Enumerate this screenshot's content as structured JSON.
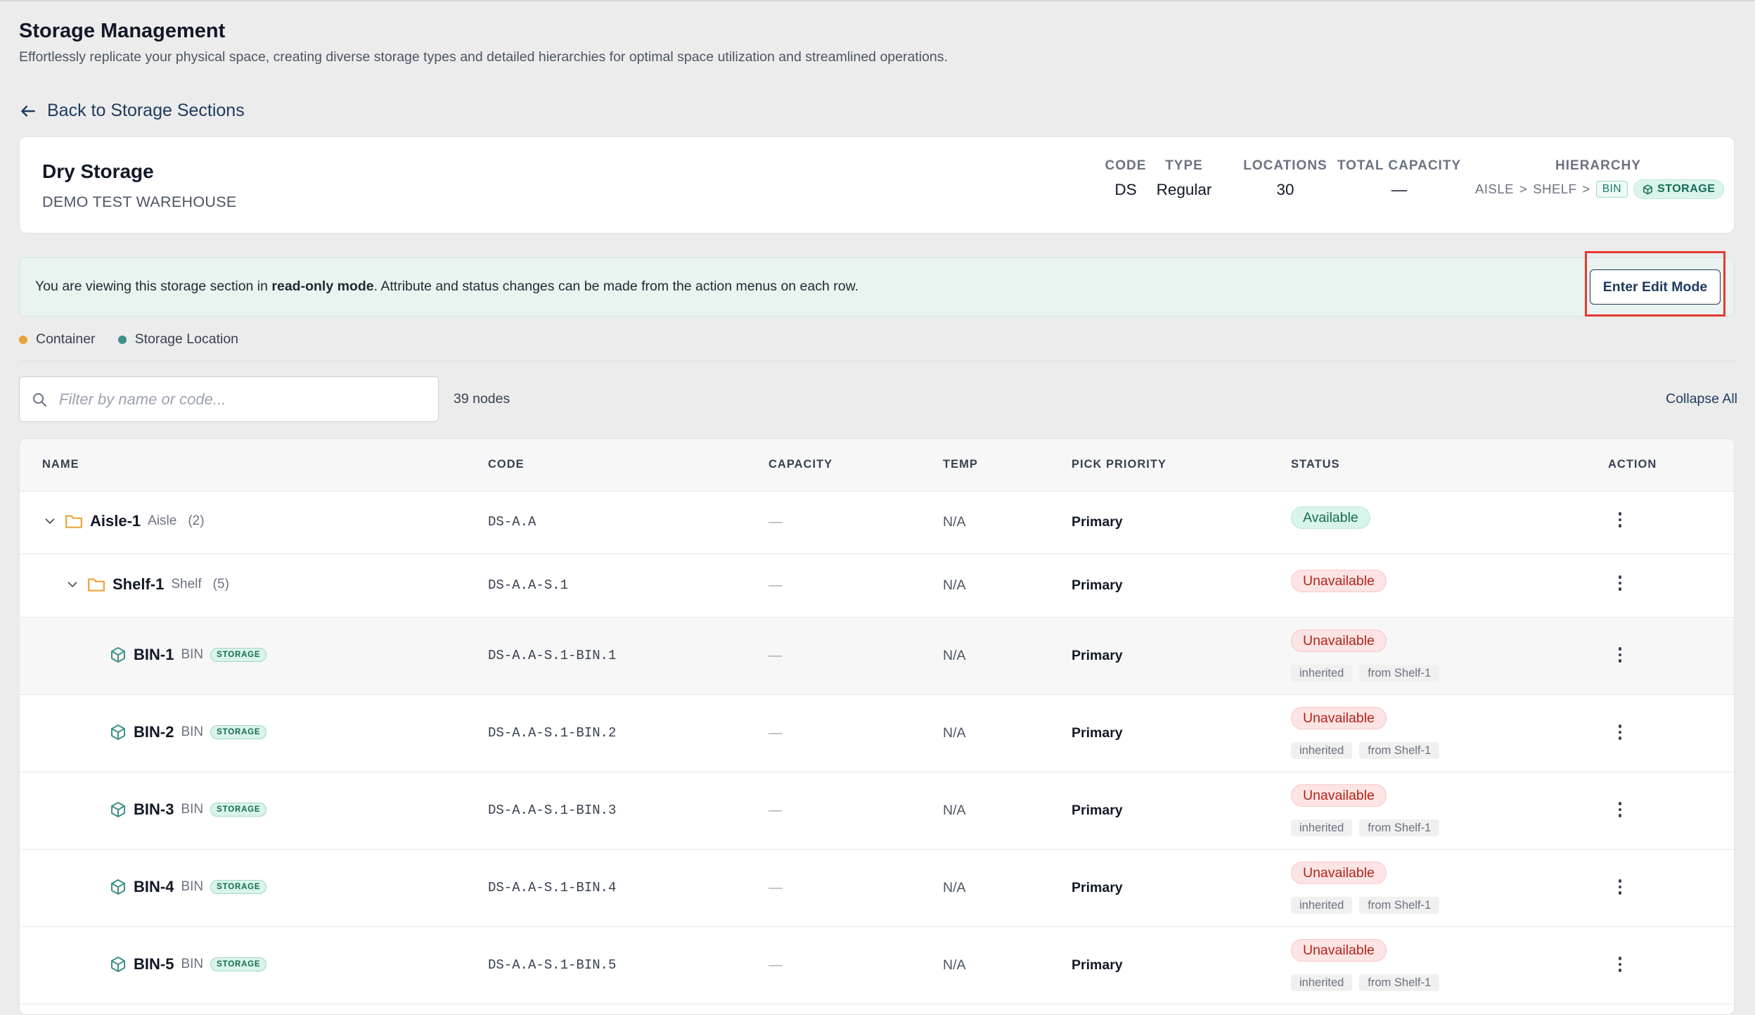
{
  "page": {
    "title": "Storage Management",
    "subtitle": "Effortlessly replicate your physical space, creating diverse storage types and detailed hierarchies for optimal space utilization and streamlined operations.",
    "back_label": "Back to Storage Sections"
  },
  "section": {
    "name": "Dry Storage",
    "warehouse": "DEMO TEST WAREHOUSE",
    "code_label": "CODE",
    "code": "DS",
    "type_label": "TYPE",
    "type": "Regular",
    "locations_label": "LOCATIONS",
    "locations": "30",
    "capacity_label": "TOTAL CAPACITY",
    "capacity": "—",
    "hierarchy_label": "HIERARCHY",
    "hierarchy": {
      "l1": "AISLE",
      "sep": ">",
      "l2": "SHELF",
      "l3": "BIN",
      "storage": "STORAGE"
    }
  },
  "notice": {
    "prefix": "You are viewing this storage section in ",
    "bold": "read-only mode",
    "suffix": ". Attribute and status changes can be made from the action menus on each row.",
    "button": "Enter Edit Mode"
  },
  "legend": {
    "container": "Container",
    "container_color": "#e8a23a",
    "storage": "Storage Location",
    "storage_color": "#3f8f8a"
  },
  "search": {
    "placeholder": "Filter by name or code...",
    "value": ""
  },
  "node_count": "39 nodes",
  "collapse_all": "Collapse All",
  "table": {
    "headers": {
      "name": "NAME",
      "code": "CODE",
      "capacity": "CAPACITY",
      "temp": "TEMP",
      "pick": "PICK PRIORITY",
      "status": "STATUS",
      "action": "ACTION"
    },
    "rows": [
      {
        "name": "Aisle-1",
        "type": "Aisle",
        "count": "(2)",
        "code": "DS-A.A",
        "capacity": "—",
        "temp": "N/A",
        "pick": "Primary",
        "status": "Available"
      },
      {
        "name": "Shelf-1",
        "type": "Shelf",
        "count": "(5)",
        "code": "DS-A.A-S.1",
        "capacity": "—",
        "temp": "N/A",
        "pick": "Primary",
        "status": "Unavailable"
      },
      {
        "name": "BIN-1",
        "type": "BIN",
        "badge": "STORAGE",
        "code": "DS-A.A-S.1-BIN.1",
        "capacity": "—",
        "temp": "N/A",
        "pick": "Primary",
        "status": "Unavailable",
        "tag1": "inherited",
        "tag2": "from Shelf-1"
      },
      {
        "name": "BIN-2",
        "type": "BIN",
        "badge": "STORAGE",
        "code": "DS-A.A-S.1-BIN.2",
        "capacity": "—",
        "temp": "N/A",
        "pick": "Primary",
        "status": "Unavailable",
        "tag1": "inherited",
        "tag2": "from Shelf-1"
      },
      {
        "name": "BIN-3",
        "type": "BIN",
        "badge": "STORAGE",
        "code": "DS-A.A-S.1-BIN.3",
        "capacity": "—",
        "temp": "N/A",
        "pick": "Primary",
        "status": "Unavailable",
        "tag1": "inherited",
        "tag2": "from Shelf-1"
      },
      {
        "name": "BIN-4",
        "type": "BIN",
        "badge": "STORAGE",
        "code": "DS-A.A-S.1-BIN.4",
        "capacity": "—",
        "temp": "N/A",
        "pick": "Primary",
        "status": "Unavailable",
        "tag1": "inherited",
        "tag2": "from Shelf-1"
      },
      {
        "name": "BIN-5",
        "type": "BIN",
        "badge": "STORAGE",
        "code": "DS-A.A-S.1-BIN.5",
        "capacity": "—",
        "temp": "N/A",
        "pick": "Primary",
        "status": "Unavailable",
        "tag1": "inherited",
        "tag2": "from Shelf-1"
      }
    ]
  }
}
